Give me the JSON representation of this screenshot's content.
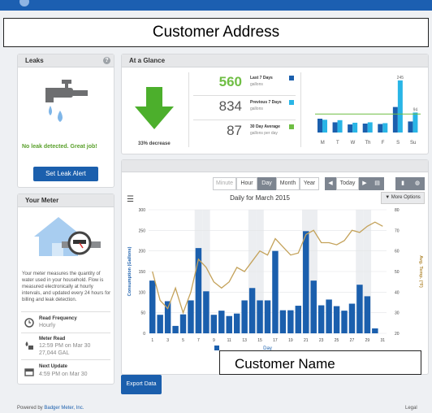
{
  "header": {
    "customer_address": "Customer Address"
  },
  "leaks": {
    "title": "Leaks",
    "status": "No leak detected. Great job!",
    "button": "Set Leak Alert"
  },
  "meter": {
    "title": "Your Meter",
    "description": "Your meter measures the quantity of water used in your household. Flow is measured electronically at hourly intervals, and updated every 24 hours for billing and leak detection.",
    "read_frequency_label": "Read Frequency",
    "read_frequency_value": "Hourly",
    "meter_read_label": "Meter Read",
    "meter_read_time": "12:59 PM on Mar 30",
    "meter_read_value": "27,044 GAL",
    "next_update_label": "Next Update",
    "next_update_value": "4:59 PM on Mar 30"
  },
  "glance": {
    "title": "At a Glance",
    "change": "33% decrease",
    "stats": [
      {
        "value": "560",
        "label": "Last 7 Days",
        "unit": "gallons",
        "color": "#1b5fad"
      },
      {
        "value": "834",
        "label": "Previous 7 Days",
        "unit": "gallons",
        "color": "#29b5e6"
      },
      {
        "value": "87",
        "label": "30 Day Average",
        "unit": "gallons per day",
        "color": "#6fbe44"
      }
    ]
  },
  "mini_chart": {
    "type": "bar",
    "categories": [
      "M",
      "T",
      "W",
      "Th",
      "F",
      "S",
      "Su"
    ],
    "series": [
      {
        "values": [
          65,
          48,
          38,
          42,
          40,
          120,
          52
        ]
      },
      {
        "values": [
          60,
          58,
          46,
          48,
          44,
          245,
          94
        ]
      }
    ],
    "data_labels": [
      "245",
      "94"
    ],
    "average": 87
  },
  "toolbar": {
    "minute": "Minute",
    "hour": "Hour",
    "day": "Day",
    "month": "Month",
    "year": "Year",
    "today": "Today",
    "more_options": "▼ More Options"
  },
  "chart_data": {
    "type": "bar",
    "title": "Daily for March 2015",
    "ylabel": "Consumption (Gallons)",
    "y2label": "Avg. Temp. (°F)",
    "xlabel": "Day",
    "ylim": [
      0,
      300
    ],
    "y2lim": [
      20,
      80
    ],
    "yticks": [
      0,
      50,
      100,
      150,
      200,
      250,
      300
    ],
    "y2ticks": [
      20,
      30,
      40,
      50,
      60,
      70,
      80
    ],
    "xticks": [
      1,
      3,
      5,
      7,
      9,
      11,
      13,
      15,
      17,
      19,
      21,
      23,
      25,
      27,
      29,
      31
    ],
    "x": [
      1,
      2,
      3,
      4,
      5,
      6,
      7,
      8,
      9,
      10,
      11,
      12,
      13,
      14,
      15,
      16,
      17,
      18,
      19,
      20,
      21,
      22,
      23,
      24,
      25,
      26,
      27,
      28,
      29,
      30,
      31
    ],
    "series": [
      {
        "values": [
          128,
          45,
          78,
          18,
          46,
          80,
          207,
          102,
          45,
          55,
          42,
          48,
          80,
          110,
          80,
          80,
          200,
          56,
          56,
          67,
          248,
          128,
          68,
          82,
          66,
          55,
          72,
          118,
          90,
          12,
          0
        ]
      },
      {
        "values": [
          50,
          36,
          32,
          42,
          30,
          40,
          56,
          52,
          45,
          42,
          45,
          52,
          50,
          55,
          60,
          58,
          66,
          62,
          58,
          59,
          68,
          70,
          64,
          64,
          63,
          65,
          70,
          69,
          72,
          74,
          72
        ]
      }
    ]
  },
  "footer": {
    "export": "Export Data",
    "powered": "Powered by",
    "brand": "Badger Meter, Inc.",
    "legal": "Legal",
    "customer_name": "Customer Name"
  },
  "colors": {
    "bar": "#1b5fad",
    "bar_light": "#29b5e6",
    "temp_line": "#c4a25a",
    "accent": "#5aa02c"
  }
}
